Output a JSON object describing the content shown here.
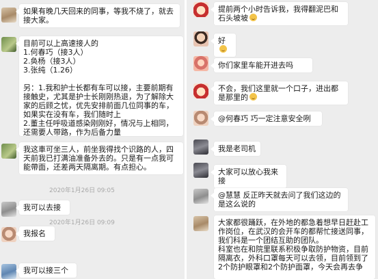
{
  "left_panel": {
    "messages": [
      {
        "id": "m1",
        "avatar": "avatar",
        "text": "如果有晚几天回来的同事，等我不烧了，就去接大家。"
      },
      {
        "id": "m2",
        "avatar": "avatar",
        "text": "目前可以上高速接人的\n1.何春巧（接3人）\n2.奂杨（接3人）\n3.张纯（1.26）\n\n另：1.我和护士长都有车可以接，主要前期有接触史，尤其是护士长刚刚热退，为了解除大家的后顾之忧，优先安排前面几位同事的车，如果实在没有车，我们随时上\n2.董主任呼吸道感染刚刚好，情况与上相同，还需要人带路，作为后备力量"
      },
      {
        "id": "m3",
        "avatar": "avatar",
        "text": "我这車可坐三人，前坐我得找个识路的人，四天前我已打满油准备外去的。只是有一点我可能帶面，还差两天隔离期。有点担心。"
      },
      {
        "id": "m4",
        "avatar": "avatar",
        "text": "我可以去接"
      },
      {
        "id": "m5",
        "avatar": "avatar",
        "text": "我报名"
      },
      {
        "id": "m6",
        "avatar": "avatar",
        "text": "我可以接三个"
      }
    ],
    "timestamps": [
      "2020年1月26日 09:05",
      "2020年1月26日 09:09"
    ]
  },
  "right_panel": {
    "messages": [
      {
        "id": "r1",
        "avatar": "avatar",
        "text": "提前两个小时告诉我，我得翻泥巴和石头坡坡",
        "emoji": "smile-emoji"
      },
      {
        "id": "r2",
        "avatar": "avatar",
        "text": "好",
        "emoji": "smile-emoji"
      },
      {
        "id": "r3",
        "avatar": "avatar",
        "text": "你们家里车能开进去吗"
      },
      {
        "id": "r4",
        "avatar": "avatar",
        "text": "不会，我们这里就一个口子，进出都是那里的",
        "emoji": "smile-emoji"
      },
      {
        "id": "r5",
        "avatar": "avatar",
        "text": "@何春巧 巧一定注意安全咧"
      },
      {
        "id": "r6",
        "avatar": "avatar",
        "text": "我是老司机"
      },
      {
        "id": "r7",
        "avatar": "avatar",
        "text": "大家可以放心我来接"
      },
      {
        "id": "r8",
        "avatar": "avatar",
        "text": "@慧慧 反正昨天就去问了我们这边的是这么说的"
      },
      {
        "id": "r9",
        "avatar": "avatar",
        "text": "大家都很踊跃，在外地的都急着想早日赶赴工作岗位，在武汉的会开车的都帮忙接送同事，我们科是一个团结互助的团队。\n科室也在和院里联系积极争取防护物资，目前隔离衣，外科口罩每天可以去领，目前领到了2个防护眼罩和2个防护面罩，今天会再去争"
      }
    ]
  }
}
